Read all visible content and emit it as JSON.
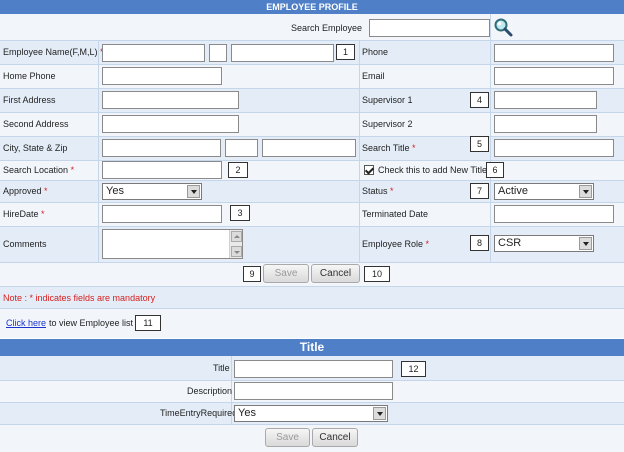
{
  "profile": {
    "header": "EMPLOYEE PROFILE",
    "search_label": "Search Employee",
    "search_value": "",
    "search_icon": "magnifier-icon",
    "fields": {
      "employee_name": "Employee Name(F,M,L)",
      "phone": "Phone",
      "home_phone": "Home Phone",
      "email": "Email",
      "first_address": "First Address",
      "supervisor1": "Supervisor 1",
      "second_address": "Second Address",
      "supervisor2": "Supervisor 2",
      "city_state_zip": "City, State & Zip",
      "search_title": "Search Title",
      "search_location": "Search Location",
      "new_title_check": "Check this to add New Title",
      "approved": "Approved",
      "status": "Status",
      "hire_date": "HireDate",
      "terminated_date": "Terminated Date",
      "comments": "Comments",
      "employee_role": "Employee Role"
    },
    "required_mark": "*",
    "selects": {
      "approved": "Yes",
      "status": "Active",
      "role": "CSR"
    },
    "callouts": [
      "1",
      "2",
      "3",
      "4",
      "5",
      "6",
      "7",
      "8",
      "9",
      "10",
      "11",
      "12"
    ],
    "buttons": {
      "save": "Save",
      "cancel": "Cancel"
    },
    "note": "Note : * indicates fields are mandatory",
    "link_text": "Click here",
    "link_suffix": "to view Employee list"
  },
  "title_section": {
    "header": "Title",
    "title_label": "Title",
    "description_label": "Description",
    "time_entry_label": "TimeEntryRequired",
    "time_entry_value": "Yes",
    "save": "Save",
    "cancel": "Cancel"
  },
  "colors": {
    "header_blue": "#4f7fc6",
    "row_shade": "#e4edf7",
    "required_red": "#d62020",
    "link_blue": "#1a33cc"
  }
}
